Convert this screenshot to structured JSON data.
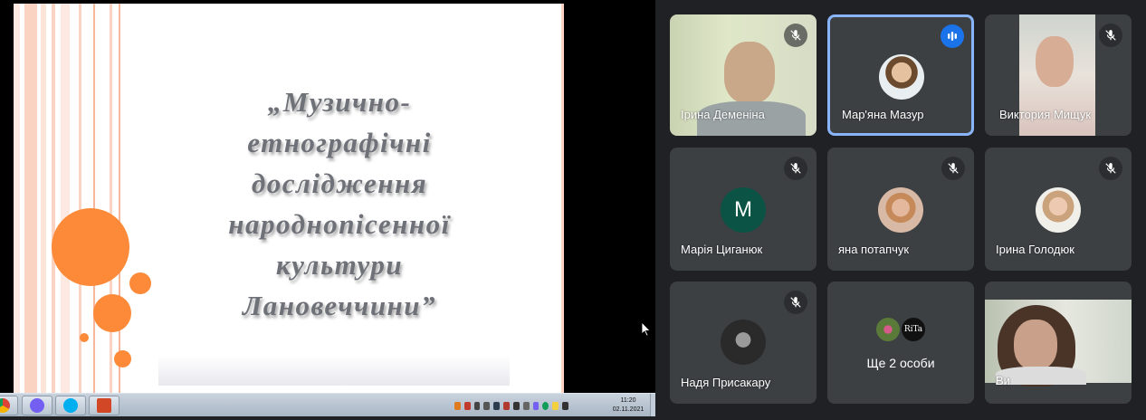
{
  "slide": {
    "title_lines": [
      "„Музично-",
      "етнографічні",
      "дослідження",
      "народнопісенної",
      "культури",
      "Лановеччини”"
    ],
    "accent_color": "#fd8a38"
  },
  "taskbar": {
    "clock_time": "11:20",
    "clock_date": "02.11.2021"
  },
  "participants": [
    {
      "name": "Ірина Деменіна",
      "muted": true,
      "mode": "video"
    },
    {
      "name": "Мар'яна Мазур",
      "muted": false,
      "speaking": true,
      "mode": "avatar"
    },
    {
      "name": "Виктория Мищук",
      "muted": true,
      "mode": "video"
    },
    {
      "name": "Марія Циганюк",
      "muted": true,
      "mode": "initial",
      "initial": "M"
    },
    {
      "name": "яна потапчук",
      "muted": true,
      "mode": "avatar"
    },
    {
      "name": "Ірина Голодюк",
      "muted": true,
      "mode": "avatar"
    },
    {
      "name": "Надя Присакару",
      "muted": true,
      "mode": "avatar"
    },
    {
      "name": "Ви",
      "muted": false,
      "mode": "video"
    }
  ],
  "more_participants": {
    "label": "Ще 2 особи",
    "avatar_text": "RiTa"
  },
  "icons": {
    "mute": "mic-off-icon",
    "speaking": "audio-level-icon",
    "cursor": "mouse-pointer-icon"
  }
}
